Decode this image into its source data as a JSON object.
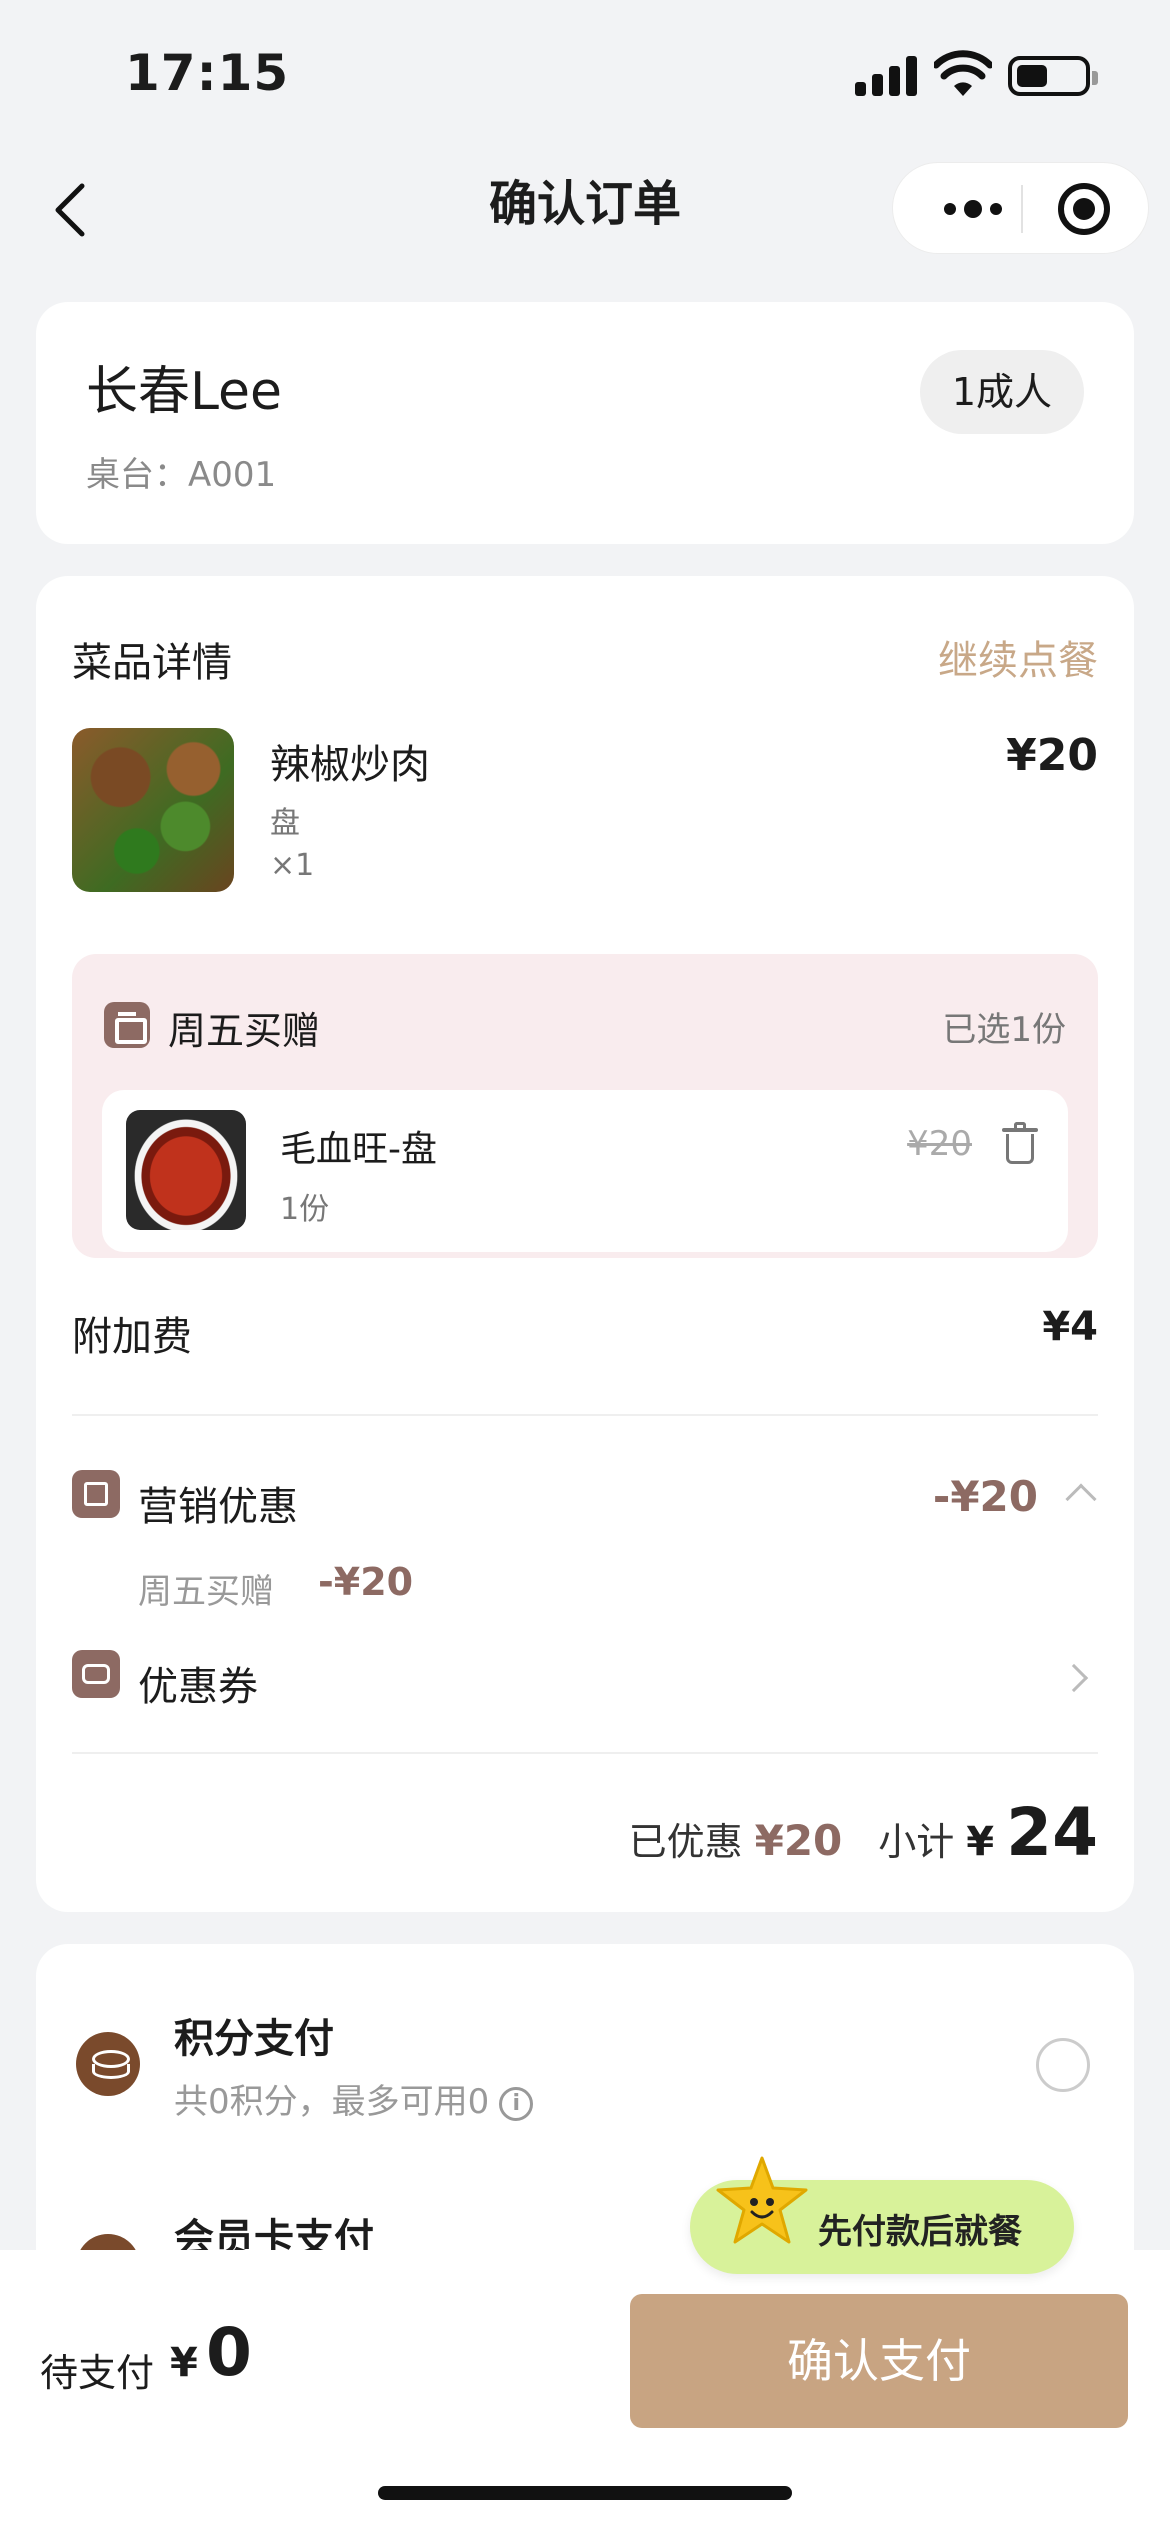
{
  "status_bar": {
    "time": "17:15"
  },
  "nav": {
    "title": "确认订单"
  },
  "user": {
    "name": "长春Lee",
    "table": "桌台：A001",
    "guests": "1成人"
  },
  "order": {
    "section_title": "菜品详情",
    "continue_label": "继续点餐",
    "dish": {
      "name": "辣椒炒肉",
      "unit": "盘",
      "qty": "×1",
      "price": "¥20"
    },
    "promo": {
      "title": "周五买赠",
      "selected": "已选1份",
      "gift": {
        "name": "毛血旺-盘",
        "count": "1份",
        "original_price": "¥20"
      }
    },
    "fee": {
      "label": "附加费",
      "value": "¥4"
    },
    "marketing": {
      "label": "营销优惠",
      "value": "-¥20",
      "detail_name": "周五买赠",
      "detail_value": "-¥20"
    },
    "coupon": {
      "label": "优惠券"
    },
    "summary": {
      "discount_label": "已优惠",
      "discount_value": "¥20",
      "subtotal_label": "小计",
      "currency": "¥",
      "subtotal_value": "24"
    }
  },
  "payment": {
    "points": {
      "title": "积分支付",
      "desc": "共0积分，最多可用0"
    },
    "member": {
      "title": "会员卡支付"
    },
    "tip": "先付款后就餐"
  },
  "bottom": {
    "pending_label": "待支付",
    "currency": "¥",
    "pending_amount": "0",
    "pay_button": "确认支付"
  },
  "colors": {
    "accent_brown": "#8d6a63",
    "link_tan": "#c8a888",
    "pay_button": "#c8a482",
    "promo_bg": "#f9ecee",
    "tip_green": "#d8f29a"
  }
}
